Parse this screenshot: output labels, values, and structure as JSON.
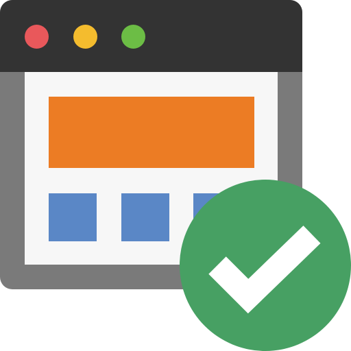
{
  "icon": {
    "window": {
      "frame_color": "#7a7a7a",
      "titlebar_color": "#333333",
      "content_color": "#f7f7f7",
      "controls": [
        {
          "name": "close-dot",
          "color": "#e9585b"
        },
        {
          "name": "minimize-dot",
          "color": "#f4bc2e"
        },
        {
          "name": "maximize-dot",
          "color": "#6cbd45"
        }
      ],
      "hero_color": "#ec7c24",
      "tile_color": "#5a87c6"
    },
    "badge": {
      "icon": "check-icon",
      "circle_color": "#47a063",
      "check_color": "#ffffff"
    }
  }
}
